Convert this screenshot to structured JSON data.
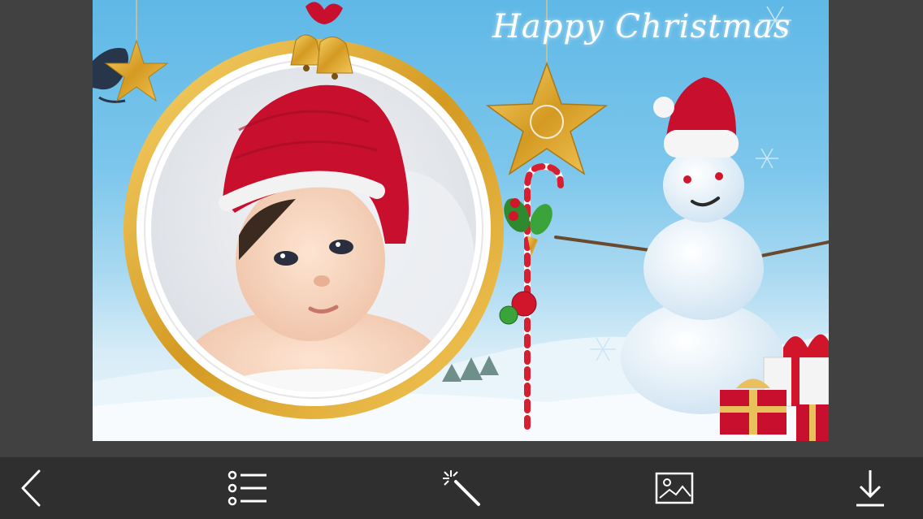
{
  "card": {
    "greeting": "Happy Christmas"
  },
  "toolbar": {
    "buttons": [
      {
        "name": "back",
        "icon": "chevron-left-icon"
      },
      {
        "name": "frames-list",
        "icon": "list-icon"
      },
      {
        "name": "effects",
        "icon": "magic-wand-icon"
      },
      {
        "name": "gallery",
        "icon": "image-icon"
      },
      {
        "name": "save",
        "icon": "download-icon"
      }
    ]
  },
  "colors": {
    "app_background": "#414141",
    "toolbar_background": "#2f2f2f",
    "icon_color": "#ffffff",
    "frame_gold": "#d4a72c",
    "sky_blue": "#5fb8e6",
    "hat_red": "#c8102e"
  }
}
